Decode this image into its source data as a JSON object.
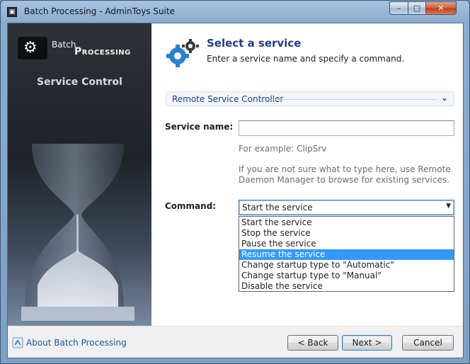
{
  "window": {
    "title": "Batch Processing - AdminToys Suite",
    "icon": "app-icon",
    "controls": {
      "minimize": "–",
      "maximize": "□",
      "close": "✕"
    }
  },
  "sidebar": {
    "brand_small": "Batch",
    "brand_big": "Processing",
    "subtitle": "Service Control",
    "logo_icon": "gear-icon",
    "illustration": "hourglass"
  },
  "header": {
    "icon": "gears-icon",
    "title": "Select a service",
    "description": "Enter a service name and specify a command."
  },
  "section": {
    "label": "Remote Service Controller",
    "chevron": "⌄"
  },
  "form": {
    "service_name_label": "Service name:",
    "service_name_value": "",
    "example_hint": "For example: ClipSrv",
    "help_line1": "If you are not sure what to type here, use Remote",
    "help_line2": "Daemon Manager to browse for existing services.",
    "command_label": "Command:",
    "command_value": "Start the service",
    "command_options": [
      "Start the service",
      "Stop the service",
      "Pause the service",
      "Resume the service",
      "Change startup type to \"Automatic\"",
      "Change startup type to \"Manual\"",
      "Disable the service"
    ],
    "highlighted_option": "Resume the service"
  },
  "footer": {
    "about_link": "About Batch Processing",
    "back_label": "< Back",
    "next_label": "Next >",
    "cancel_label": "Cancel"
  },
  "colors": {
    "accent_title": "#1e3d8a",
    "link": "#1a55a8",
    "selection": "#3399ff",
    "sidebar_dark": "#1f2328"
  }
}
